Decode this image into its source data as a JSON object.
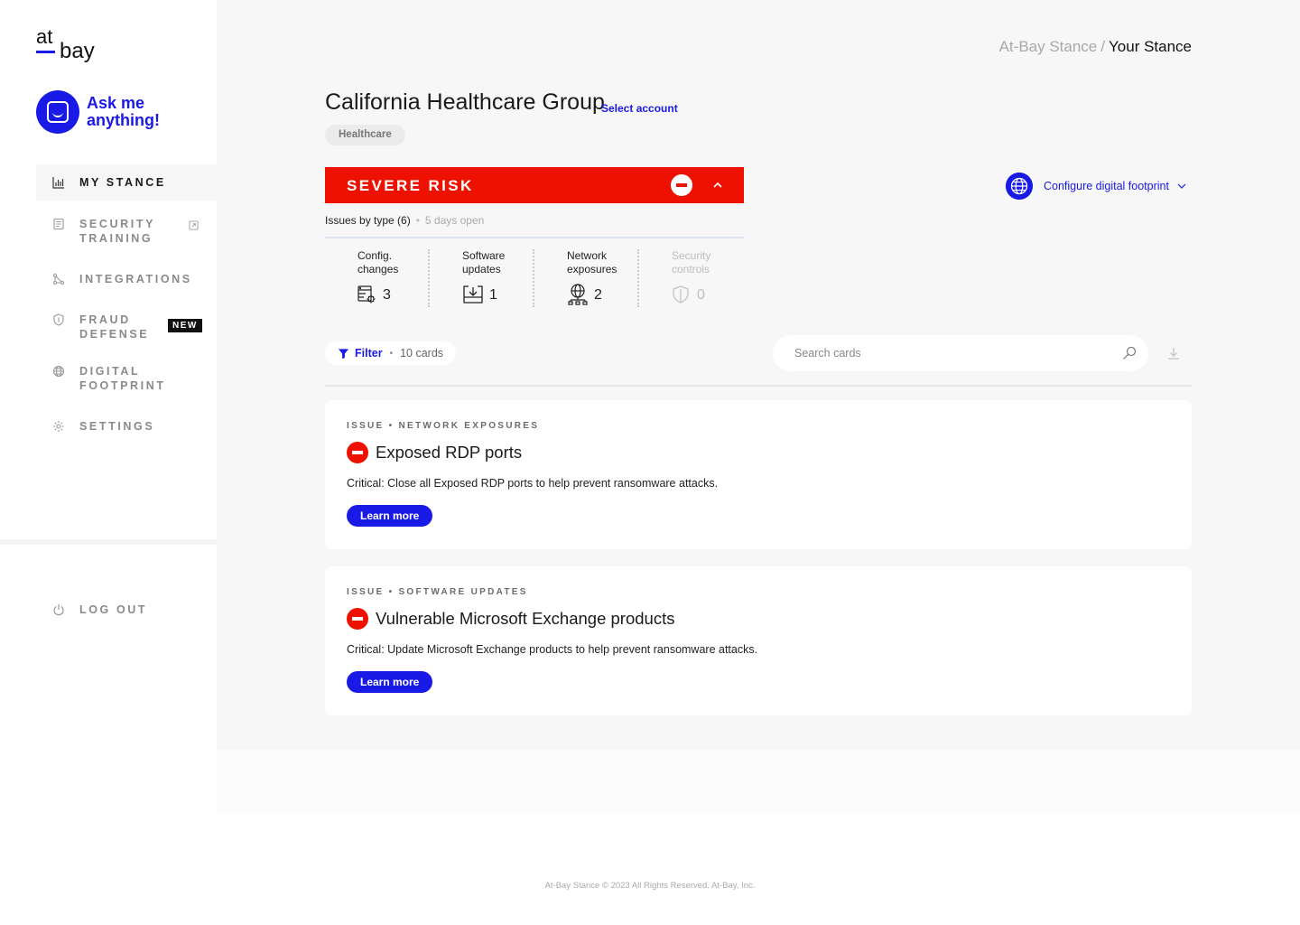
{
  "logo": {
    "line1": "at",
    "line2": "bay"
  },
  "assistant": {
    "label": "Ask me anything!"
  },
  "sidebar": {
    "items": [
      {
        "label": "MY STANCE",
        "icon": "bar-chart-icon",
        "active": true
      },
      {
        "label": "SECURITY TRAINING",
        "icon": "document-icon",
        "external_icon": "external-link-icon"
      },
      {
        "label": "INTEGRATIONS",
        "icon": "nodes-icon"
      },
      {
        "label": "FRAUD DEFENSE",
        "icon": "shield-icon",
        "badge": "NEW"
      },
      {
        "label": "DIGITAL FOOTPRINT",
        "icon": "globe-icon"
      },
      {
        "label": "SETTINGS",
        "icon": "gear-icon"
      }
    ],
    "logout": {
      "label": "LOG OUT",
      "icon": "power-icon"
    }
  },
  "breadcrumb": {
    "parent": "At-Bay Stance",
    "separator": "/",
    "current": "Your Stance"
  },
  "account": {
    "name": "California Healthcare Group",
    "select_label": "Select account",
    "industry": "Healthcare"
  },
  "risk": {
    "label": "SEVERE RISK",
    "color": "#ee1100"
  },
  "issues": {
    "summary": "Issues by type (6)",
    "age": "5 days open",
    "types": [
      {
        "name_line1": "Config.",
        "name_line2": "changes",
        "count": "3",
        "icon": "config-gear-icon"
      },
      {
        "name_line1": "Software",
        "name_line2": "updates",
        "count": "1",
        "icon": "download-tray-icon"
      },
      {
        "name_line1": "Network",
        "name_line2": "exposures",
        "count": "2",
        "icon": "network-globe-icon"
      },
      {
        "name_line1": "Security",
        "name_line2": "controls",
        "count": "0",
        "icon": "shield-icon",
        "disabled": true
      }
    ]
  },
  "configure": {
    "label": "Configure digital footprint"
  },
  "toolbar": {
    "filter_label": "Filter",
    "cards_count": "10 cards",
    "search_placeholder": "Search cards"
  },
  "cards": [
    {
      "kicker": "ISSUE • NETWORK EXPOSURES",
      "title": "Exposed RDP ports",
      "description": "Critical: Close all Exposed RDP ports to help prevent ransomware attacks.",
      "button": "Learn more"
    },
    {
      "kicker": "ISSUE • SOFTWARE UPDATES",
      "title": "Vulnerable Microsoft Exchange products",
      "description": "Critical: Update Microsoft Exchange products to help prevent ransomware attacks.",
      "button": "Learn more"
    }
  ],
  "footer": {
    "text": "At-Bay Stance © 2023 All Rights Reserved. At-Bay, Inc."
  },
  "colors": {
    "accent": "#1a1ae6",
    "danger": "#ee1100"
  }
}
